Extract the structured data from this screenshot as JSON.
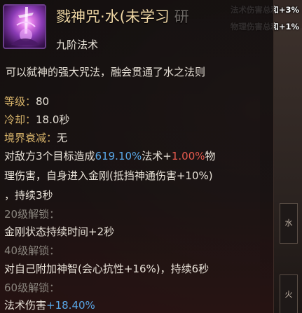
{
  "buffs": [
    "法术伤害总和+3%",
    "物理伤害总和+1%"
  ],
  "side_slots": [
    "水",
    "火"
  ],
  "skill": {
    "title_main": "戮神咒·水(未学习",
    "title_faded": "研",
    "rank": "九阶法术",
    "description": "可以弑神的强大咒法，融会贯通了水之法则",
    "level_label": "等级：",
    "level_value": "80",
    "cooldown_label": "冷却：",
    "cooldown_value": "18.0秒",
    "decay_label": "境界衰减：",
    "decay_value": "无",
    "effect": {
      "part1": "对敌方3个目标造成",
      "pct1": "619.10%",
      "part2": "法术+",
      "pct2": "1.00%",
      "part3": "物",
      "line2": "理伤害，自身进入金刚(抵挡神通伤害+10%)",
      "line3": "，持续3秒"
    },
    "unlocks": [
      {
        "label": "20级解锁：",
        "text": "金刚状态持续时间+2秒"
      },
      {
        "label": "40级解锁：",
        "text": "对自己附加神智(会心抗性+16%)，持续6秒"
      },
      {
        "label": "60级解锁：",
        "text_prefix": "法术伤害",
        "text_value": "+18.40%"
      }
    ]
  },
  "colors": {
    "title": "#f2d9a6",
    "stat_key": "#d8b46a",
    "body": "#e8e2d8",
    "blue": "#59a6e6",
    "red": "#e65a4e",
    "locked": "#8a857e"
  }
}
